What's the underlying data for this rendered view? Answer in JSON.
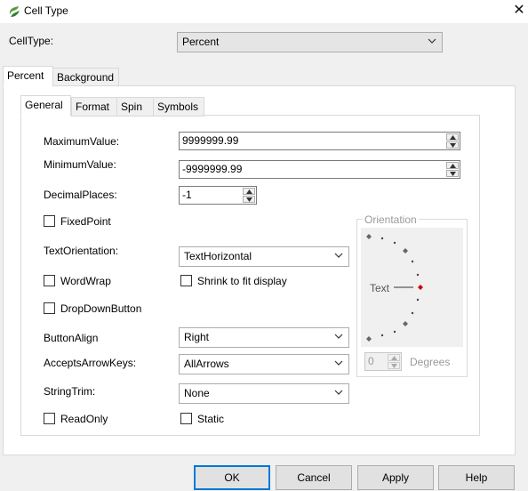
{
  "window": {
    "title": "Cell Type",
    "close_glyph": "✕",
    "app_icon": "spread-logo-icon"
  },
  "celltype": {
    "label": "CellType:",
    "value": "Percent"
  },
  "outer_tabs": [
    {
      "label": "Percent",
      "active": true
    },
    {
      "label": "Background",
      "active": false
    }
  ],
  "inner_tabs": [
    {
      "label": "General",
      "active": true
    },
    {
      "label": "Format",
      "active": false
    },
    {
      "label": "Spin",
      "active": false
    },
    {
      "label": "Symbols",
      "active": false
    }
  ],
  "general": {
    "maximum_label": "MaximumValue:",
    "maximum_value": "9999999.99",
    "minimum_label": "MinimumValue:",
    "minimum_value": "-9999999.99",
    "decimal_label": "DecimalPlaces:",
    "decimal_value": "-1",
    "fixedpoint_label": "FixedPoint",
    "textorientation_label": "TextOrientation:",
    "textorientation_value": "TextHorizontal",
    "wordwrap_label": "WordWrap",
    "shrink_label": "Shrink to fit display",
    "dropdown_label": "DropDownButton",
    "buttonalign_label": "ButtonAlign",
    "buttonalign_value": "Right",
    "arrowkeys_label": "AcceptsArrowKeys:",
    "arrowkeys_value": "AllArrows",
    "stringtrim_label": "StringTrim:",
    "stringtrim_value": "None",
    "readonly_label": "ReadOnly",
    "static_label": "Static"
  },
  "orientation": {
    "group_label": "Orientation",
    "text_label": "Text",
    "degrees_value": "0",
    "degrees_label": "Degrees",
    "accent": "#cc0000"
  },
  "buttons": {
    "ok": "OK",
    "cancel": "Cancel",
    "apply": "Apply",
    "help": "Help"
  },
  "colors": {
    "default_button_border": "#0078d7",
    "dialog_background": "#f0f0f0"
  }
}
